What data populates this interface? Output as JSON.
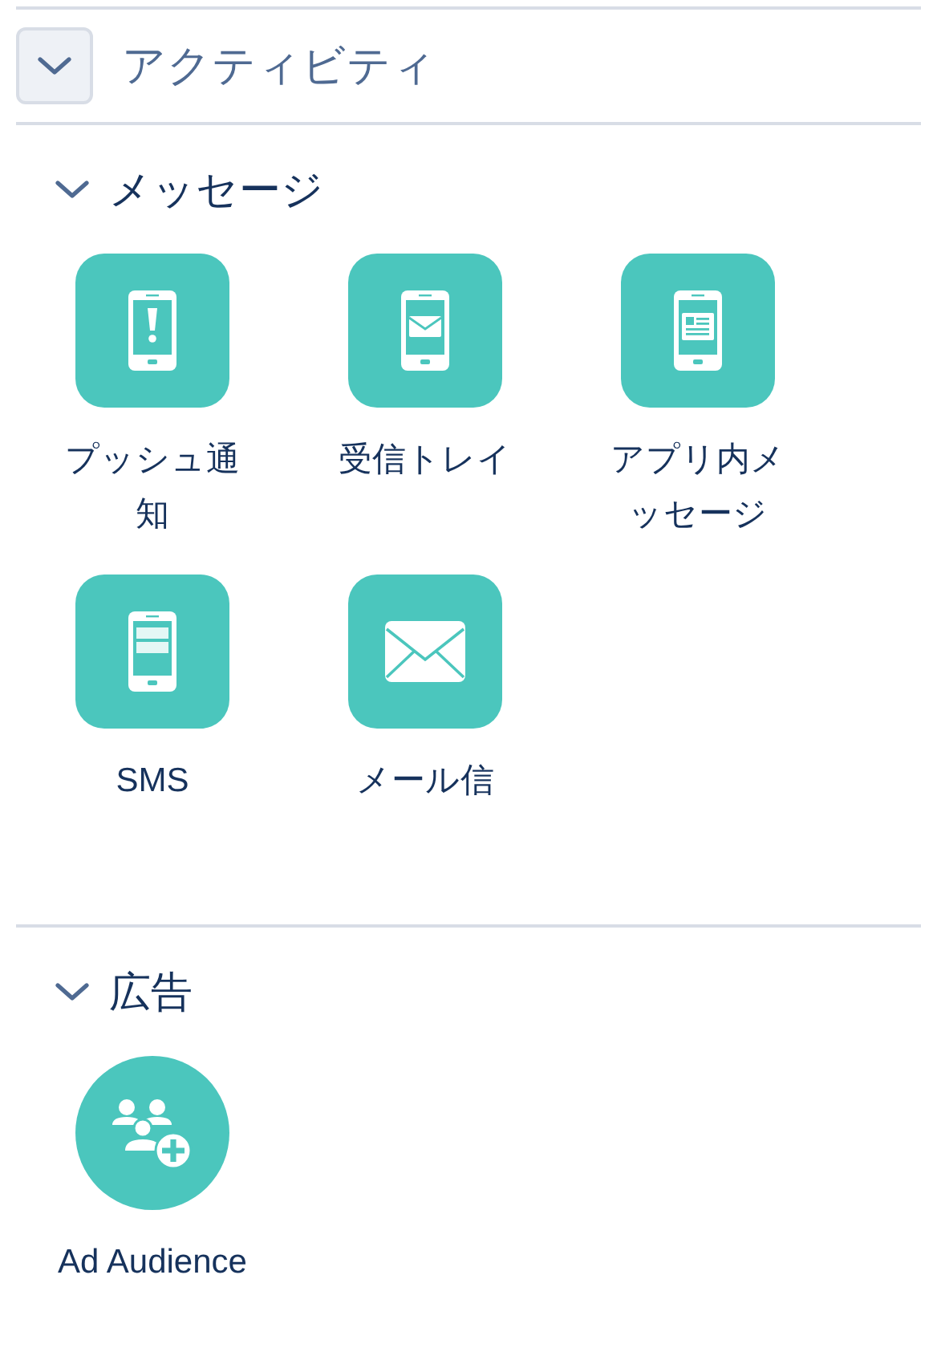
{
  "panel": {
    "title": "アクティビティ",
    "expanded": true
  },
  "sections": [
    {
      "title": "メッセージ",
      "expanded": true,
      "items": [
        {
          "label": "プッシュ通知",
          "kind": "push"
        },
        {
          "label": "受信トレイ",
          "kind": "inbox"
        },
        {
          "label": "アプリ内メッセージ",
          "kind": "inapp"
        },
        {
          "label": "SMS",
          "kind": "sms"
        },
        {
          "label": "メール信",
          "kind": "email"
        }
      ]
    },
    {
      "title": "広告",
      "expanded": true,
      "items": [
        {
          "label": "Ad Audience",
          "kind": "audience"
        }
      ]
    }
  ]
}
